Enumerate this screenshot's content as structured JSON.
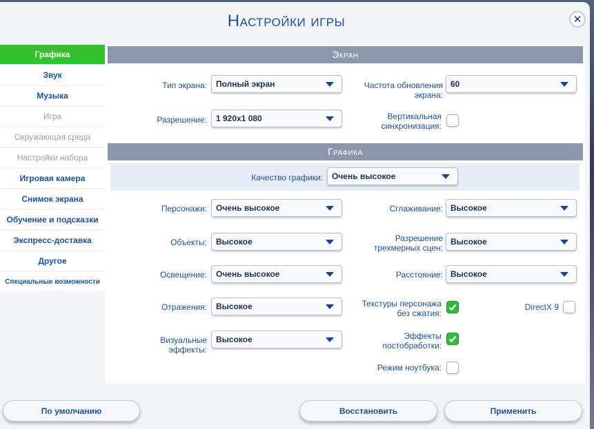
{
  "window": {
    "title": "Настройки игры"
  },
  "sidebar": {
    "items": [
      {
        "label": "Графика"
      },
      {
        "label": "Звук"
      },
      {
        "label": "Музыка"
      },
      {
        "label": "Игра"
      },
      {
        "label": "Окружающая среда"
      },
      {
        "label": "Настройки набора"
      },
      {
        "label": "Игровая камера"
      },
      {
        "label": "Снимок экрана"
      },
      {
        "label": "Обучение и подсказки"
      },
      {
        "label": "Экспресс-доставка"
      },
      {
        "label": "Другое"
      },
      {
        "label": "Специальные возможности"
      }
    ],
    "active_index": 0,
    "disabled_indices": [
      3,
      4,
      5
    ]
  },
  "screen_section": {
    "header": "Экран",
    "screen_type": {
      "label": "Тип экрана:",
      "value": "Полный экран"
    },
    "refresh_rate": {
      "label_line1": "Частота обновления",
      "label_line2": "экрана:",
      "value": "60"
    },
    "resolution": {
      "label": "Разрешение:",
      "value": "1 920x1 080"
    },
    "vsync": {
      "label_line1": "Вертикальная",
      "label_line2": "синхронизация:",
      "checked": false
    }
  },
  "graphics_section": {
    "header": "Графика",
    "quality": {
      "label": "Качество графики:",
      "value": "Очень высокое"
    },
    "characters": {
      "label": "Персонажи:",
      "value": "Очень высокое"
    },
    "antialiasing": {
      "label": "Сглаживание:",
      "value": "Высокое"
    },
    "objects": {
      "label": "Объекты:",
      "value": "Высокое"
    },
    "resolution_3d": {
      "label_line1": "Разрешение",
      "label_line2": "трехмерных сцен:",
      "value": "Высокое"
    },
    "lighting": {
      "label": "Освещение:",
      "value": "Очень высокое"
    },
    "distance": {
      "label": "Расстояние:",
      "value": "Высокое"
    },
    "reflections": {
      "label": "Отражения:",
      "value": "Высокое"
    },
    "uncompressed_textures": {
      "label_line1": "Текстуры персонажа",
      "label_line2": "без сжатия:",
      "checked": true
    },
    "directx9": {
      "label": "DirectX 9",
      "checked": false
    },
    "visual_effects": {
      "label_line1": "Визуальные",
      "label_line2": "эффекты:",
      "value": "Высокое"
    },
    "post_processing": {
      "label_line1": "Эффекты",
      "label_line2": "постобработки:",
      "checked": true
    },
    "laptop_mode": {
      "label": "Режим ноутбука:",
      "checked": false
    }
  },
  "footer": {
    "default_label": "По умолчанию",
    "restore_label": "Восстановить",
    "apply_label": "Применить"
  },
  "colors": {
    "accent_green": "#34c12e",
    "label_blue": "#1c4f9c",
    "header_gray": "#8b98ac"
  }
}
